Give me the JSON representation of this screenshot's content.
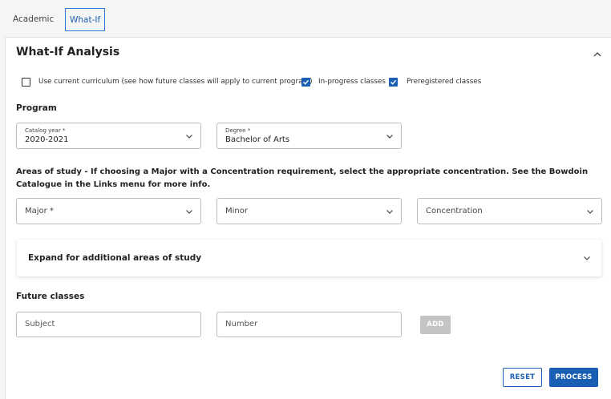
{
  "tabs": [
    {
      "label": "Academic",
      "active": false
    },
    {
      "label": "What-If",
      "active": true
    }
  ],
  "panel": {
    "title": "What-If Analysis"
  },
  "options": [
    {
      "label": "Use current curriculum (see how future classes will apply to current program)",
      "checked": false
    },
    {
      "label": "In-progress classes",
      "checked": true
    },
    {
      "label": "Preregistered classes",
      "checked": true
    }
  ],
  "program": {
    "heading": "Program",
    "catalog_year": {
      "label": "Catalog year *",
      "value": "2020-2021"
    },
    "degree": {
      "label": "Degree *",
      "value": "Bachelor of Arts"
    }
  },
  "areas": {
    "heading": "Areas of study - If choosing a Major with a Concentration requirement, select the appropriate concentration. See the Bowdoin Catalogue in the Links menu for more info.",
    "major_placeholder": "Major *",
    "minor_placeholder": "Minor",
    "concentration_placeholder": "Concentration",
    "expand_label": "Expand for additional areas of study"
  },
  "future_classes": {
    "heading": "Future classes",
    "subject_placeholder": "Subject",
    "number_placeholder": "Number",
    "add_label": "ADD"
  },
  "actions": {
    "reset_label": "RESET",
    "process_label": "PROCESS"
  },
  "colors": {
    "accent": "#1a5fb4",
    "disabled": "#c4c4c4"
  },
  "icons": {
    "collapse": "chevron-up-icon",
    "dropdown": "chevron-down-icon",
    "checked": "check-icon"
  }
}
